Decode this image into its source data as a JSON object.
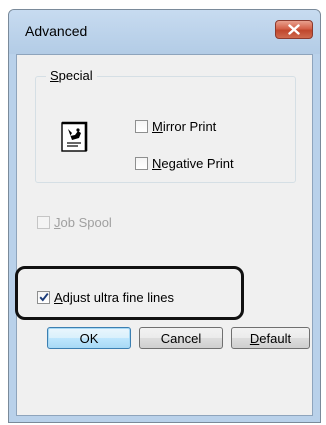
{
  "window": {
    "title": "Advanced"
  },
  "special_group": {
    "label_mnemonic": "S",
    "label_rest": "pecial",
    "mirror_print": {
      "mnemonic": "M",
      "rest": "irror Print",
      "checked": false
    },
    "negative_print": {
      "mnemonic": "N",
      "rest": "egative Print",
      "checked": false
    }
  },
  "job_spool": {
    "mnemonic": "J",
    "rest": "ob Spool",
    "checked": false,
    "enabled": false
  },
  "adjust_fine_lines": {
    "mnemonic": "A",
    "rest": "djust ultra fine lines",
    "checked": true
  },
  "buttons": {
    "ok_label": "OK",
    "cancel_label": "Cancel",
    "default_mnemonic": "D",
    "default_rest": "efault"
  },
  "colors": {
    "frame": "#b9d1ea",
    "client": "#f0f0f0",
    "close_button": "#c7452c"
  }
}
